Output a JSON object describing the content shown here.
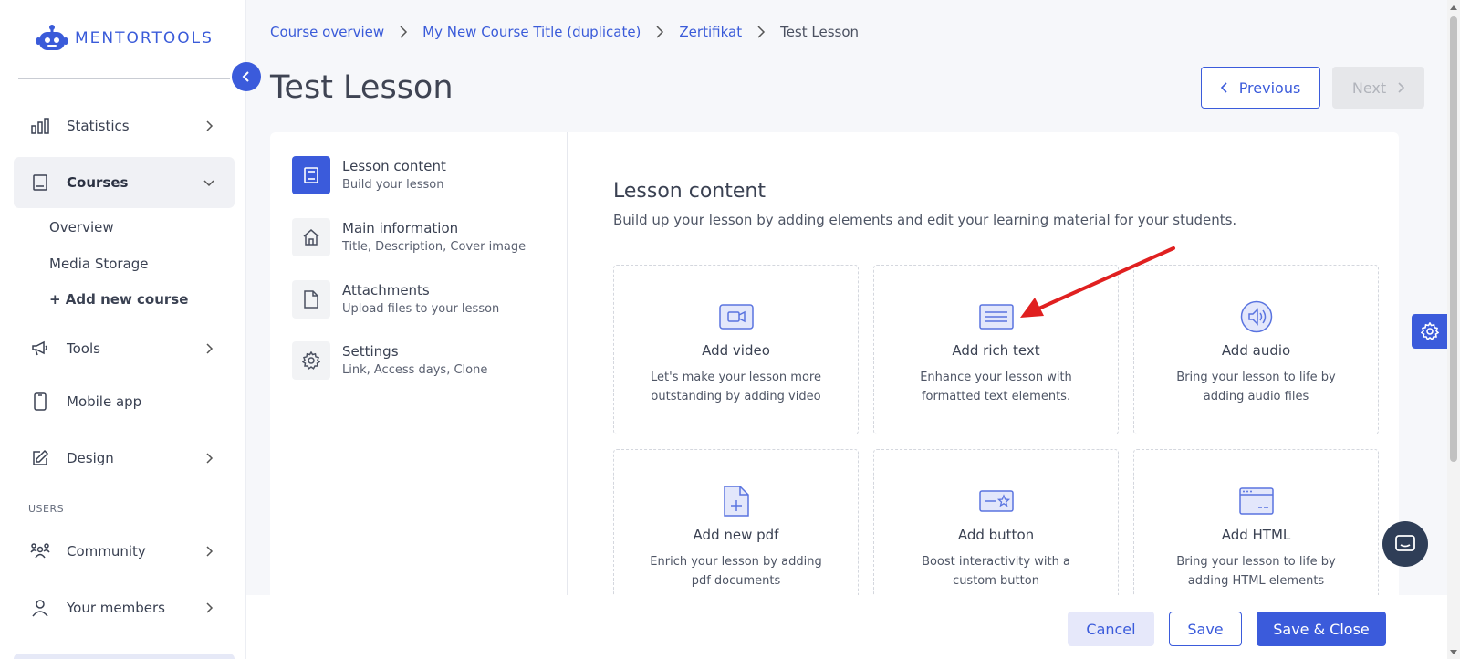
{
  "app": {
    "logo_text": "MENTORTOOLS"
  },
  "sidebar": {
    "items": [
      {
        "label": "Statistics",
        "icon": "bar-chart-icon"
      },
      {
        "label": "Courses",
        "icon": "book-icon"
      },
      {
        "label": "Tools",
        "icon": "megaphone-icon"
      },
      {
        "label": "Mobile app",
        "icon": "phone-icon"
      },
      {
        "label": "Design",
        "icon": "edit-icon"
      },
      {
        "label": "Community",
        "icon": "people-icon"
      },
      {
        "label": "Your members",
        "icon": "user-icon"
      }
    ],
    "course_subitems": [
      "Overview",
      "Media Storage",
      "+ Add new course"
    ],
    "users_section_label": "USERS"
  },
  "breadcrumb": {
    "items": [
      "Course overview",
      "My New Course Title (duplicate)",
      "Zertifikat",
      "Test Lesson"
    ]
  },
  "page": {
    "title": "Test Lesson",
    "previous_label": "Previous",
    "next_label": "Next"
  },
  "steps": [
    {
      "title": "Lesson content",
      "subtitle": "Build your lesson",
      "icon": "book-icon"
    },
    {
      "title": "Main information",
      "subtitle": "Title, Description, Cover image",
      "icon": "home-icon"
    },
    {
      "title": "Attachments",
      "subtitle": "Upload files to your lesson",
      "icon": "file-icon"
    },
    {
      "title": "Settings",
      "subtitle": "Link, Access days, Clone",
      "icon": "gear-icon"
    }
  ],
  "lesson_content": {
    "title": "Lesson content",
    "subtitle": "Build up your lesson by adding elements and edit your learning material for your students.",
    "tiles": [
      {
        "title": "Add video",
        "desc": "Let's make your lesson more outstanding by adding video",
        "icon": "video-icon"
      },
      {
        "title": "Add rich text",
        "desc": "Enhance your lesson with formatted text elements.",
        "icon": "rich-text-icon"
      },
      {
        "title": "Add audio",
        "desc": "Bring your lesson to life by adding audio files",
        "icon": "audio-icon"
      },
      {
        "title": "Add new pdf",
        "desc": "Enrich your lesson by adding pdf documents",
        "icon": "pdf-icon"
      },
      {
        "title": "Add button",
        "desc": "Boost interactivity with a custom button",
        "icon": "button-icon"
      },
      {
        "title": "Add HTML",
        "desc": "Bring your lesson to life by adding HTML elements",
        "icon": "html-icon"
      }
    ]
  },
  "footer": {
    "cancel_label": "Cancel",
    "save_label": "Save",
    "save_close_label": "Save & Close"
  },
  "colors": {
    "accent": "#3b5bdb",
    "annotation_arrow": "#e02020"
  }
}
